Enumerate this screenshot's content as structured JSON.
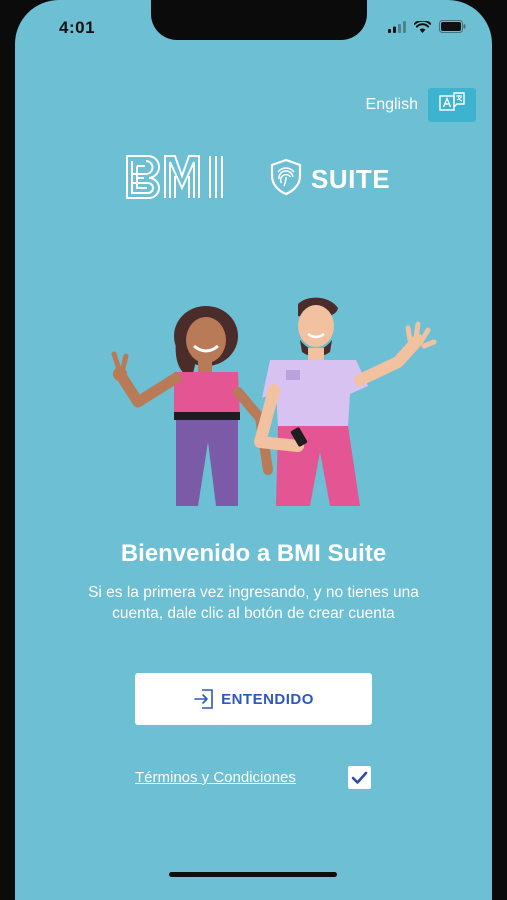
{
  "status_bar": {
    "time": "4:01",
    "icons": [
      "signal-icon",
      "wifi-icon",
      "battery-icon"
    ]
  },
  "language": {
    "label": "English",
    "icon": "translate-icon"
  },
  "logo": {
    "brand": "BMI",
    "product": "SUITE",
    "icon": "shield-fingerprint-icon"
  },
  "welcome": {
    "title": "Bienvenido a BMI Suite",
    "subtitle": "Si es la primera vez ingresando, y no tienes una cuenta, dale clic al botón de crear cuenta"
  },
  "cta": {
    "label": "ENTENDIDO",
    "icon": "login-icon"
  },
  "terms": {
    "label": "Términos y Condiciones",
    "checked": true
  },
  "colors": {
    "background": "#6dbfd3",
    "accent": "#3eb3cf",
    "button_text": "#2d58c0",
    "text": "#ffffff"
  }
}
